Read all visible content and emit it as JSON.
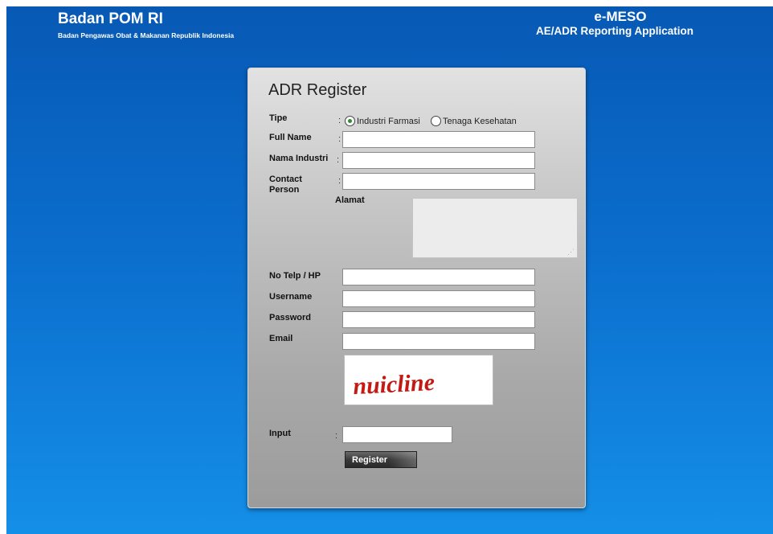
{
  "header": {
    "brand_title": "Badan POM RI",
    "brand_subtitle": "Badan Pengawas Obat & Makanan Republik Indonesia",
    "app_title": "e-MESO",
    "app_subtitle": "AE/ADR Reporting Application"
  },
  "form": {
    "title": "ADR Register",
    "colon": ":",
    "tipe": {
      "label": "Tipe",
      "options": [
        "Industri Farmasi",
        "Tenaga Kesehatan"
      ],
      "selected": "Industri Farmasi"
    },
    "full_name": {
      "label": "Full Name",
      "value": ""
    },
    "nama_industri": {
      "label": "Nama Industri",
      "value": ""
    },
    "contact_person": {
      "label": "Contact Person",
      "value": ""
    },
    "alamat": {
      "label": "Alamat",
      "value": ""
    },
    "no_telp": {
      "label": "No Telp / HP",
      "value": ""
    },
    "username": {
      "label": "Username",
      "value": ""
    },
    "password": {
      "label": "Password",
      "value": ""
    },
    "email": {
      "label": "Email",
      "value": ""
    },
    "captcha": {
      "text": "nuicline"
    },
    "input": {
      "label": "Input",
      "value": ""
    },
    "register_label": "Register"
  },
  "colors": {
    "background_top": "#0759b4",
    "background_bottom": "#148fe8",
    "captcha_text": "#c41a14"
  }
}
